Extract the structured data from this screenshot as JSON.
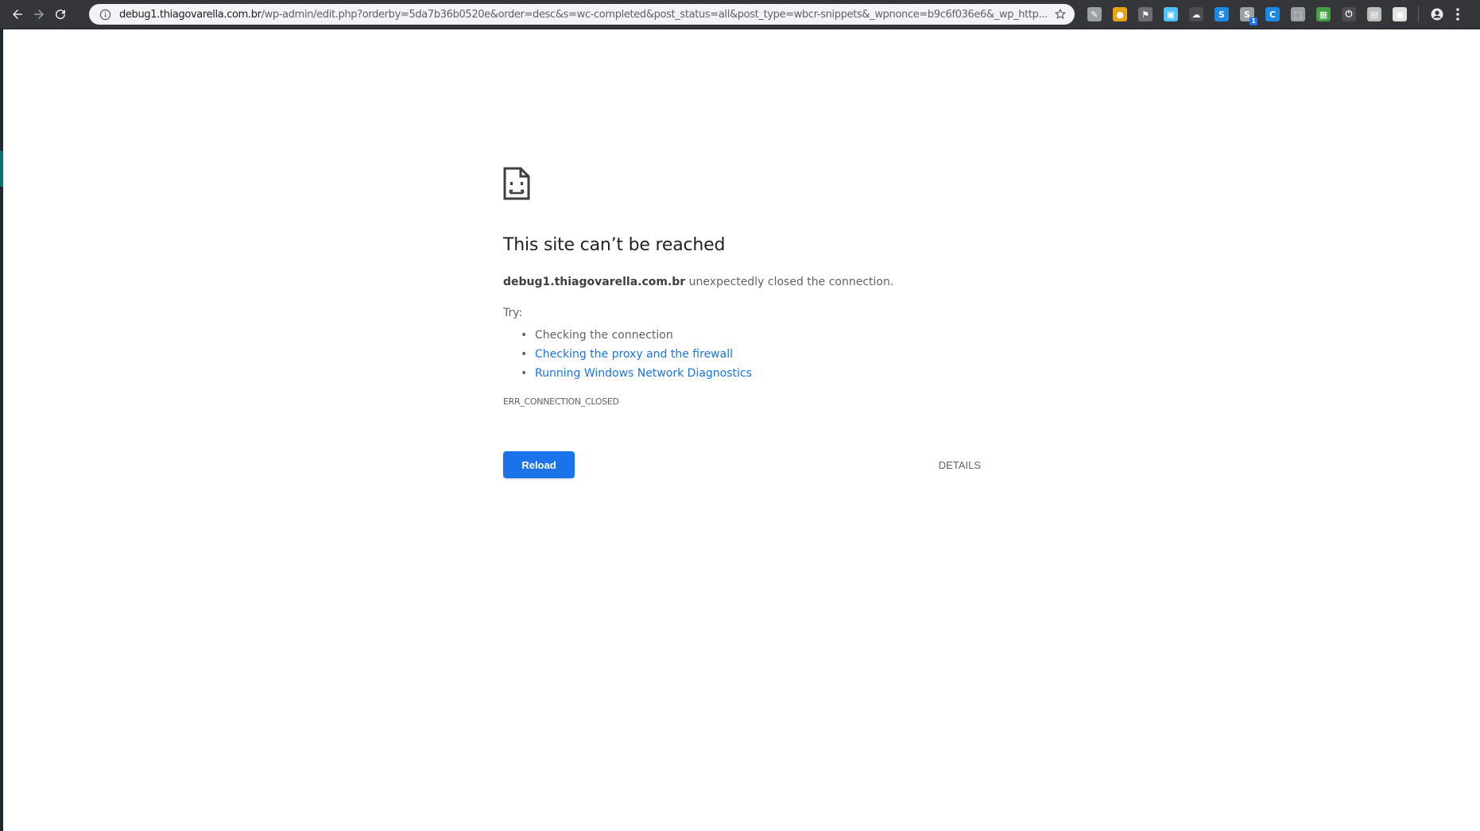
{
  "browser": {
    "url_host": "debug1.thiagovarella.com.br",
    "url_rest": "/wp-admin/edit.php?orderby=5da7b36b0520e&order=desc&s=wc-completed&post_status=all&post_type=wbcr-snippets&_wpnonce=b9c6f036e6&_wp_http...",
    "icons": {
      "back": "arrow-left-icon",
      "forward": "arrow-right-icon",
      "reload": "reload-icon",
      "info": "info-icon",
      "bookmark": "star-icon",
      "account": "account-icon",
      "menu": "kebab-menu-icon"
    },
    "extensions": [
      {
        "name": "pen-extension-icon",
        "color": "#9aa0a6",
        "glyph": "✎"
      },
      {
        "name": "honey-extension-icon",
        "color": "#e8a317",
        "glyph": "●"
      },
      {
        "name": "flag-extension-icon",
        "color": "#6b6f73",
        "glyph": "⚑"
      },
      {
        "name": "save-extension-icon",
        "color": "#4fc3f7",
        "glyph": "▣"
      },
      {
        "name": "cloud-extension-icon",
        "color": "#4a4d52",
        "glyph": "☁"
      },
      {
        "name": "s-extension-icon",
        "color": "#1e88e5",
        "glyph": "S"
      },
      {
        "name": "s-badge-extension-icon",
        "color": "#9aa0a6",
        "glyph": "S",
        "badge": "1"
      },
      {
        "name": "circle-extension-icon",
        "color": "#1e88e5",
        "glyph": "C"
      },
      {
        "name": "screenshot-extension-icon",
        "color": "#9aa0a6",
        "glyph": "⬚"
      },
      {
        "name": "window-extension-icon",
        "color": "#43a047",
        "glyph": "▦"
      },
      {
        "name": "power-extension-icon",
        "color": "#4a4d52",
        "glyph": "⏻"
      },
      {
        "name": "page-extension-icon",
        "color": "#bdbdbd",
        "glyph": "▤"
      },
      {
        "name": "box-extension-icon",
        "color": "#e0e0e0",
        "glyph": "▣"
      }
    ]
  },
  "error_page": {
    "title": "This site can’t be reached",
    "host": "debug1.thiagovarella.com.br",
    "message": " unexpectedly closed the connection.",
    "try_label": "Try:",
    "suggestions": [
      {
        "text": "Checking the connection",
        "link": false
      },
      {
        "text": "Checking the proxy and the firewall",
        "link": true
      },
      {
        "text": "Running Windows Network Diagnostics",
        "link": true
      }
    ],
    "error_code": "ERR_CONNECTION_CLOSED",
    "reload_label": "Reload",
    "details_label": "DETAILS",
    "accent_color": "#1a73e8"
  }
}
